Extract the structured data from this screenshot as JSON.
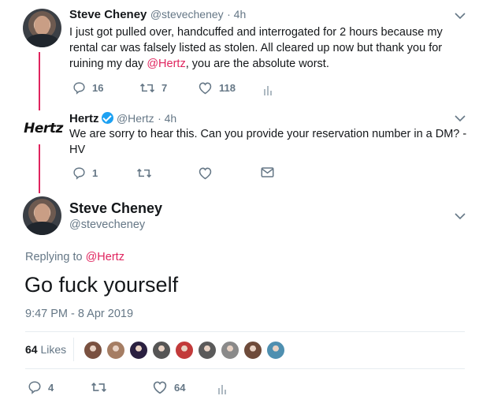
{
  "tweet1": {
    "name": "Steve Cheney",
    "handle": "@stevecheney",
    "time": "· 4h",
    "text_before": "I just got pulled over, handcuffed and interrogated for 2 hours because my rental car was falsely listed as stolen. All cleared up now but thank you for ruining my day ",
    "mention": "@Hertz",
    "text_after": ", you are the absolute worst.",
    "replies": "16",
    "retweets": "7",
    "likes": "118"
  },
  "tweet2": {
    "name": "Hertz",
    "handle": "@Hertz",
    "time": "· 4h",
    "logo_text": "Hertz",
    "text": "We are sorry to hear this. Can you provide your reservation number in a DM? -HV",
    "replies": "1"
  },
  "main_tweet": {
    "name": "Steve Cheney",
    "handle": "@stevecheney",
    "replying_prefix": "Replying to ",
    "replying_to": "@Hertz",
    "text": "Go fuck yourself",
    "timestamp": "9:47 PM - 8 Apr 2019",
    "likes_count": "64",
    "likes_label": "Likes",
    "replies": "4",
    "likes": "64"
  },
  "colors": {
    "accent": "#e0245e",
    "secondary_text": "#657786",
    "verified": "#1da1f2",
    "divider": "#e6ecf0"
  },
  "liker_avatars": [
    "#7a5140",
    "#a57d63",
    "#2a2040",
    "#555555",
    "#c23a3a",
    "#5a5a5a",
    "#8a8a8a",
    "#6e4b3a",
    "#4e8fb0"
  ]
}
